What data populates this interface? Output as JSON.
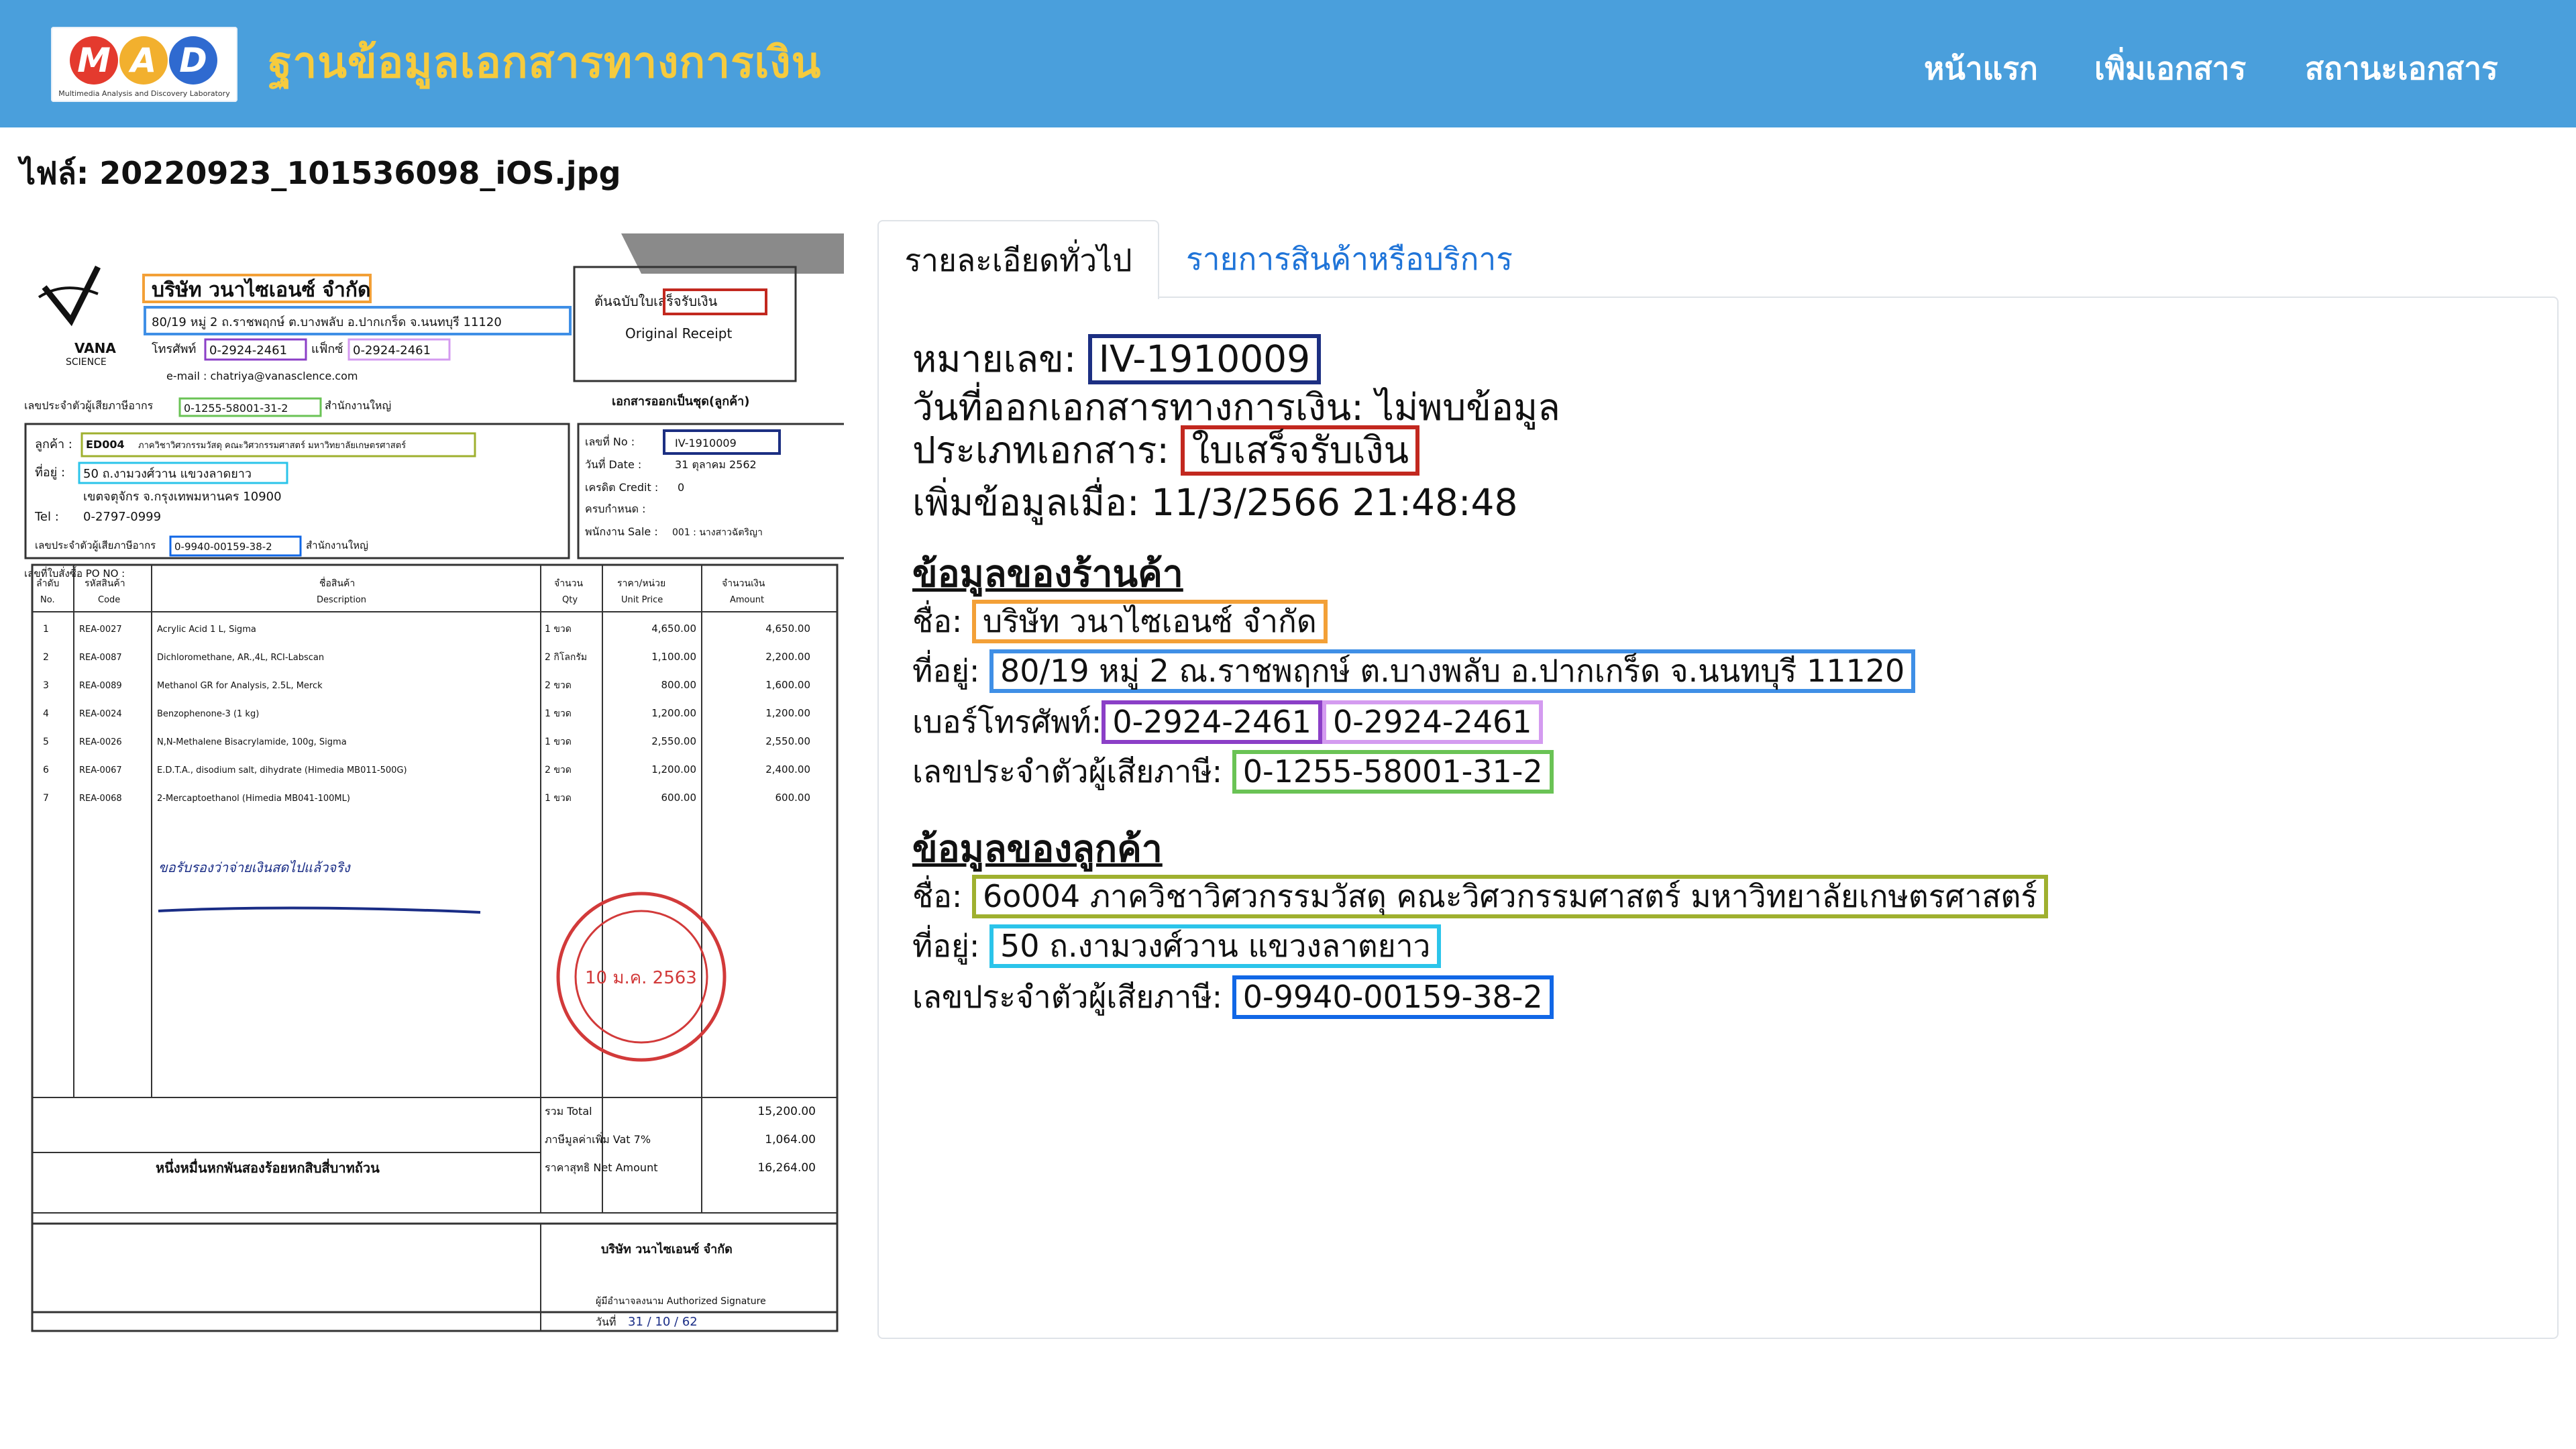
{
  "app": {
    "brand": "ฐานข้อมูลเอกสารทางการเงิน",
    "logo": {
      "letters": [
        "M",
        "A",
        "D"
      ],
      "tagline": "Multimedia Analysis and Discovery Laboratory"
    },
    "nav": [
      "หน้าแรก",
      "เพิ่มเอกสาร",
      "สถานะเอกสาร"
    ]
  },
  "file_label": "ไฟล์: 20220923_101536098_iOS.jpg",
  "tabs": {
    "general": "รายละเอียดทั่วไป",
    "items": "รายการสินค้าหรือบริการ"
  },
  "general": {
    "doc_no_label": "หมายเลข:",
    "doc_no": "IV-1910009",
    "issue_date_label": "วันที่ออกเอกสารทางการเงิน:",
    "issue_date": "ไม่พบข้อมูล",
    "doc_type_label": "ประเภทเอกสาร:",
    "doc_type": "ใบเสร็จรับเงิน",
    "added_label": "เพิ่มข้อมูลเมื่อ:",
    "added": "11/3/2566 21:48:48"
  },
  "seller": {
    "heading": "ข้อมูลของร้านค้า",
    "name_label": "ชื่อ:",
    "name": "บริษัท วนาไซเอนซ์ จำกัด",
    "address_label": "ที่อยู่:",
    "address": "80/19 หมู่ 2 ณ.ราชพฤกษ์ ต.บางพลับ อ.ปากเกร็ด จ.นนทบุรี 11120",
    "phone_label": "เบอร์โทรศัพท์:",
    "phone1": "0-2924-2461",
    "phone2": "0-2924-2461",
    "tax_label": "เลขประจำตัวผู้เสียภาษี:",
    "tax_id": "0-1255-58001-31-2"
  },
  "customer": {
    "heading": "ข้อมูลของลูกค้า",
    "name_label": "ชื่อ:",
    "name": "6o004 ภาควิชาวิศวกรรมวัสดุ คณะวิศวกรรมศาสตร์ มหาวิทยาลัยเกษตรศาสตร์",
    "address_label": "ที่อยู่:",
    "address": "50 ถ.งามวงศ์วาน แขวงลาตยาว",
    "tax_label": "เลขประจำตัวผู้เสียภาษี:",
    "tax_id": "0-9940-00159-38-2"
  },
  "receipt": {
    "company": "บริษัท วนาไซเอนซ์ จำกัด",
    "address": "80/19 หมู่ 2 ถ.ราชพฤกษ์ ต.บางพลับ อ.ปากเกร็ด จ.นนทบุรี 11120",
    "phone_label": "โทรศัพท์",
    "phone": "0-2924-2461",
    "fax_label": "แฟ็กซ์",
    "fax": "0-2924-2461",
    "email": "e-mail : chatriya@vanasclence.com",
    "seller_tax_label": "เลขประจำตัวผู้เสียภาษีอากร",
    "seller_tax": "0-1255-58001-31-2",
    "branch": "สำนักงานใหญ่",
    "original_th": "ต้นฉบับใบเสร็จรับเงิน",
    "original_en": "Original Receipt",
    "series": "เอกสารออกเป็นชุด(ลูกค้า)",
    "customer_label": "ลูกค้า :",
    "customer_code": "ED004",
    "customer_name": "ภาควิชาวิศวกรรมวัสดุ คณะวิศวกรรมศาสตร์ มหาวิทยาลัยเกษตรศาสตร์",
    "address_label": "ที่อยู่ :",
    "cust_address1": "50 ถ.งามวงศ์วาน แขวงลาดยาว",
    "cust_address2": "เขตจตุจักร จ.กรุงเทพมหานคร 10900",
    "tel_label": "Tel :",
    "tel": "0-2797-0999",
    "cust_tax_label": "เลขประจำตัวผู้เสียภาษีอากร",
    "cust_tax": "0-9940-00159-38-2",
    "cust_branch": "สำนักงานใหญ่",
    "po_label": "เลขที่ใบสั่งซื้อ PO NO :",
    "no_label": "เลขที่ No :",
    "no": "IV-1910009",
    "date_label": "วันที่ Date :",
    "date": "31 ตุลาคม 2562",
    "credit_label": "เครดิต Credit :",
    "credit": "0",
    "due_label": "ครบกำหนด :",
    "sales_label": "พนักงาน Sale :",
    "sales": "001 : นางสาวฉัตริญา",
    "headers": [
      {
        "th": "ลำดับ",
        "en": "No."
      },
      {
        "th": "รหัสสินค้า",
        "en": "Code"
      },
      {
        "th": "ชื่อสินค้า",
        "en": "Description"
      },
      {
        "th": "จำนวน",
        "en": "Qty"
      },
      {
        "th": "ราคา/หน่วย",
        "en": "Unit Price"
      },
      {
        "th": "จำนวนเงิน",
        "en": "Amount"
      }
    ],
    "rows": [
      [
        "1",
        "REA-0027",
        "Acrylic Acid 1 L, Sigma",
        "1 ขวด",
        "4,650.00",
        "4,650.00"
      ],
      [
        "2",
        "REA-0087",
        "Dichloromethane, AR.,4L, RCI-Labscan",
        "2 กิโลกรัม",
        "1,100.00",
        "2,200.00"
      ],
      [
        "3",
        "REA-0089",
        "Methanol GR for Analysis, 2.5L, Merck",
        "2 ขวด",
        "800.00",
        "1,600.00"
      ],
      [
        "4",
        "REA-0024",
        "Benzophenone-3 (1 kg)",
        "1 ขวด",
        "1,200.00",
        "1,200.00"
      ],
      [
        "5",
        "REA-0026",
        "N,N-Methalene Bisacrylamide, 100g, Sigma",
        "1 ขวด",
        "2,550.00",
        "2,550.00"
      ],
      [
        "6",
        "REA-0067",
        "E.D.T.A., disodium salt, dihydrate (Himedia MB011-500G)",
        "2 ขวด",
        "1,200.00",
        "2,400.00"
      ],
      [
        "7",
        "REA-0068",
        "2-Mercaptoethanol (Himedia MB041-100ML)",
        "1 ขวด",
        "600.00",
        "600.00"
      ]
    ],
    "handwritten": "ขอรับรองว่าจ่ายเงินสดไปแล้วจริง",
    "total_label": "รวม Total",
    "total": "15,200.00",
    "vat_label": "ภาษีมูลค่าเพิ่ม Vat 7%",
    "vat": "1,064.00",
    "net_label": "ราคาสุทธิ Net Amount",
    "net": "16,264.00",
    "amount_words": "หนึ่งหมื่นหกพันสองร้อยหกสิบสี่บาทถ้วน",
    "sig_company": "บริษัท วนาไซเอนซ์ จำกัด",
    "sig_label": "ผู้มีอำนาจลงนาม Authorized Signature",
    "sig_date_label": "วันที่",
    "sig_date": "31 / 10 / 62",
    "stamp_date": "10 ม.ค. 2563"
  },
  "colors": {
    "navbar": "#4a9fdc",
    "brand": "#f6cb3e",
    "box_doc_no": "#1c2f82",
    "box_type": "#c2281f",
    "box_seller_name": "#f3a037",
    "box_seller_address": "#3f8fe6",
    "box_phone1": "#8b3fc7",
    "box_phone2": "#d49bf0",
    "box_seller_tax": "#6ac355",
    "box_customer_name": "#9fb02f",
    "box_customer_address": "#2bc4ea",
    "box_customer_tax": "#1167e6"
  }
}
